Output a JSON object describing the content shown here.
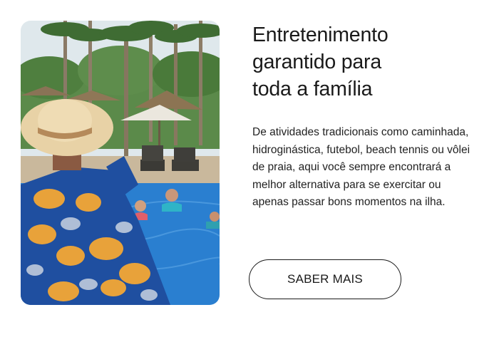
{
  "feature": {
    "heading": "Entretenimento\ngarantido para\ntoda a família",
    "description": "De atividades tradicionais como caminhada, hidroginástica, futebol, beach tennis ou vôlei de praia, aqui você sempre encontrará a melhor alternativa para se exercitar ou apenas passar bons momentos na ilha.",
    "button_label": "SABER MAIS"
  },
  "colors": {
    "pool_water": "#2a7fd0",
    "sky": "#d9e4ea",
    "foliage": "#3d6b34",
    "shirt": "#1f4fa0",
    "shirt_pattern": "#e8a23a",
    "hat": "#e6cfa3",
    "text": "#1a1a1a"
  },
  "image": {
    "icon": "resort-pool-photo"
  }
}
